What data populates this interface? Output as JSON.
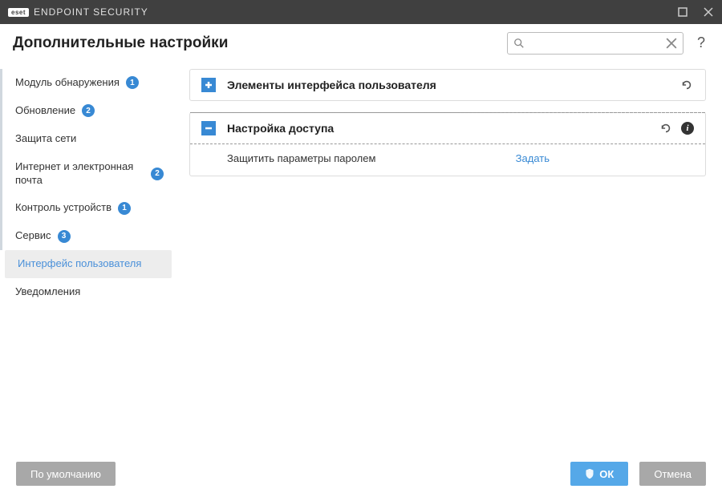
{
  "titlebar": {
    "brand": "eset",
    "product": "ENDPOINT SECURITY"
  },
  "header": {
    "title": "Дополнительные настройки",
    "search_placeholder": ""
  },
  "sidebar": {
    "items": [
      {
        "label": "Модуль обнаружения",
        "badge": "1",
        "active": false,
        "bordered": true
      },
      {
        "label": "Обновление",
        "badge": "2",
        "active": false,
        "bordered": true
      },
      {
        "label": "Защита сети",
        "badge": null,
        "active": false,
        "bordered": true
      },
      {
        "label": "Интернет и электронная почта",
        "badge": "2",
        "active": false,
        "bordered": true
      },
      {
        "label": "Контроль устройств",
        "badge": "1",
        "active": false,
        "bordered": true
      },
      {
        "label": "Сервис",
        "badge": "3",
        "active": false,
        "bordered": true
      },
      {
        "label": "Интерфейс пользователя",
        "badge": null,
        "active": true,
        "bordered": false
      },
      {
        "label": "Уведомления",
        "badge": null,
        "active": false,
        "bordered": false
      }
    ]
  },
  "sections": [
    {
      "title": "Элементы интерфейса пользователя",
      "expanded": false,
      "show_info": false
    },
    {
      "title": "Настройка доступа",
      "expanded": true,
      "show_info": true,
      "settings": [
        {
          "label": "Защитить параметры паролем",
          "action": "Задать"
        }
      ]
    }
  ],
  "footer": {
    "default": "По умолчанию",
    "ok": "ОК",
    "cancel": "Отмена"
  }
}
